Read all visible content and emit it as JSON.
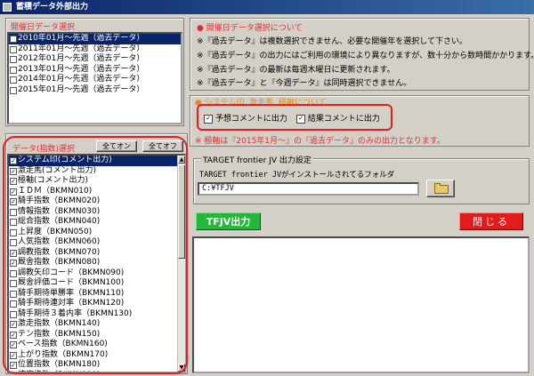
{
  "window": {
    "title": "蓄積データ外部出力"
  },
  "date_group": {
    "title": "開催日データ選択",
    "items": [
      {
        "label": "2010年01月～先週（過去データ）",
        "selected": true
      },
      {
        "label": "2011年01月～先週（過去データ）",
        "selected": false
      },
      {
        "label": "2012年01月～先週（過去データ）",
        "selected": false
      },
      {
        "label": "2013年01月～先週（過去データ）",
        "selected": false
      },
      {
        "label": "2014年01月～先週（過去データ）",
        "selected": false
      },
      {
        "label": "2015年01月～先週（過去データ）",
        "selected": false
      }
    ]
  },
  "data_group": {
    "title": "データ(指数)選択",
    "all_on_label": "全てオン",
    "all_off_label": "全てオフ",
    "items": [
      {
        "label": "システム印(コメント出力)",
        "checked": true,
        "selected": true
      },
      {
        "label": "激走馬(コメント出力)",
        "checked": true,
        "selected": false
      },
      {
        "label": "極軸(コメント出力)",
        "checked": true,
        "selected": false
      },
      {
        "label": "ＩＤＭ（BKMN010)",
        "checked": true,
        "selected": false
      },
      {
        "label": "騎手指数（BKMN020)",
        "checked": true,
        "selected": false
      },
      {
        "label": "情報指数（BKMN030)",
        "checked": false,
        "selected": false
      },
      {
        "label": "総合指数（BKMN040)",
        "checked": false,
        "selected": false
      },
      {
        "label": "上昇度（BKMN050)",
        "checked": false,
        "selected": false
      },
      {
        "label": "人気指数（BKMN060)",
        "checked": false,
        "selected": false
      },
      {
        "label": "調教指数（BKMN070)",
        "checked": true,
        "selected": false
      },
      {
        "label": "厩舎指数（BKMN080)",
        "checked": true,
        "selected": false
      },
      {
        "label": "調教矢印コード（BKMN090)",
        "checked": false,
        "selected": false
      },
      {
        "label": "厩舎評価コード（BKMN100)",
        "checked": false,
        "selected": false
      },
      {
        "label": "騎手期待単勝率（BKMN110)",
        "checked": false,
        "selected": false
      },
      {
        "label": "騎手期待連対率（BKMN120)",
        "checked": false,
        "selected": false
      },
      {
        "label": "騎手期待３着内率（BKMN130)",
        "checked": false,
        "selected": false
      },
      {
        "label": "激走指数（BKMN140)",
        "checked": true,
        "selected": false
      },
      {
        "label": "テン指数（BKMN150)",
        "checked": true,
        "selected": false
      },
      {
        "label": "ペース指数（BKMN160)",
        "checked": true,
        "selected": false
      },
      {
        "label": "上がり指数（BKMN170)",
        "checked": true,
        "selected": false
      },
      {
        "label": "位置指数（BKMN180)",
        "checked": true,
        "selected": false
      },
      {
        "label": "速度指数（BKMN190)",
        "checked": true,
        "selected": false
      },
      {
        "label": "展開指数（BKMN200)",
        "checked": true,
        "selected": false
      }
    ]
  },
  "about_group": {
    "title": "● 開催日データ選択について",
    "lines": [
      "※『過去データ』は複数選択できません、必要な開催年を選択して下さい。",
      "※『過去データ』の出力にはご利用の環境により異なりますが、数十分から数時間かかります。",
      "※『過去データ』の最新は毎週木曜日に更新されます。",
      "※『過去データ』と『今週データ』は同時選択できません。"
    ]
  },
  "system_group": {
    "title": "● システム印, 激走馬, 極軸について",
    "predict_label": "予想コメントに出力",
    "result_label": "結果コメントに出力",
    "predict_checked": true,
    "result_checked": true,
    "note": "※ 極軸は『2015年1月～』の『過去データ』のみの出力となります。"
  },
  "install_group": {
    "title": "TARGET frontier JV 出力設定",
    "description": "TARGET frontier JVがインストールされてるフォルダ",
    "path_value": "C:¥TFJV"
  },
  "actions": {
    "output_label": "TFJV出力",
    "close_label": "閉じる"
  },
  "colors": {
    "selection": "#0a246a",
    "output_button": "#22b83a",
    "close_button": "#e41b1b",
    "highlight_oval": "#e02020"
  }
}
